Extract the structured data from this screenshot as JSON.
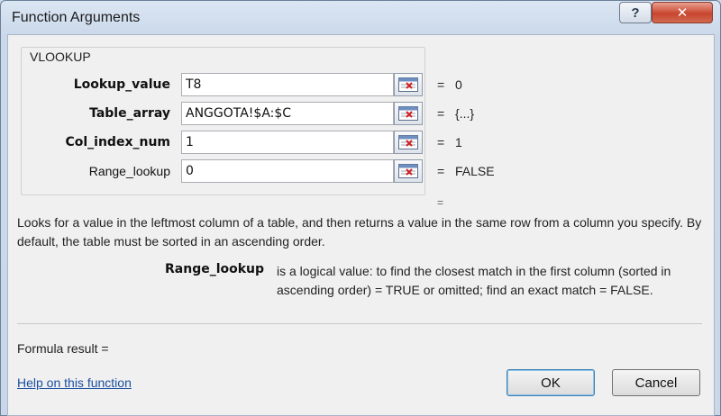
{
  "window": {
    "title": "Function Arguments",
    "help_label": "?",
    "close_label": "✕"
  },
  "function_name": "VLOOKUP",
  "arguments": [
    {
      "label": "Lookup_value",
      "bold": true,
      "value": "T8",
      "result": "0"
    },
    {
      "label": "Table_array",
      "bold": true,
      "value": "ANGGOTA!$A:$C",
      "result": "{...}"
    },
    {
      "label": "Col_index_num",
      "bold": true,
      "value": "1",
      "result": "1"
    },
    {
      "label": "Range_lookup",
      "bold": false,
      "value": "0",
      "result": "FALSE"
    }
  ],
  "equals_sign": "=",
  "overall_equals": "=",
  "description": "Looks for a value in the leftmost column of a table, and then returns a value in the same row from a column you specify. By default, the table must be sorted in an ascending order.",
  "arg_help": {
    "name": "Range_lookup",
    "text": "is a logical value: to find the closest match in the first column (sorted in ascending order) = TRUE or omitted; find an exact match = FALSE."
  },
  "formula_result": "Formula result =",
  "help_link": "Help on this function",
  "buttons": {
    "ok": "OK",
    "cancel": "Cancel"
  },
  "icons": {
    "help": "help-icon",
    "close": "close-icon",
    "ref_collapse": "range-select-icon"
  }
}
